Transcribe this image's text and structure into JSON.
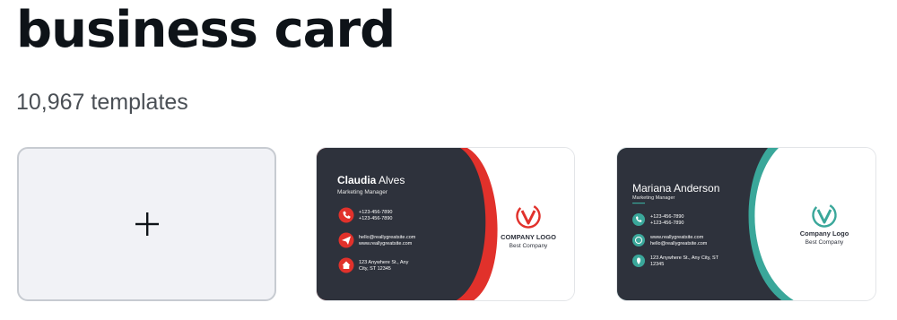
{
  "header": {
    "title": "business card",
    "template_count": "10,967 templates"
  },
  "create_blank": {
    "icon": "plus-icon"
  },
  "templates": [
    {
      "first_name": "Claudia",
      "last_name": "Alves",
      "job_title": "Marketing Manager",
      "phone_1": "+123-456-7890",
      "phone_2": "+123-456-7890",
      "email": "hello@reallygreatsite.com",
      "website": "www.reallygreatsite.com",
      "address_1": "123 Anywhere St., Any",
      "address_2": "City, ST 12345",
      "logo_text": "COMPANY LOGO",
      "company": "Best Company",
      "accent_color": "#e1312b",
      "dark_color": "#2e323c"
    },
    {
      "name": "Mariana Anderson",
      "job_title": "Marketing Manager",
      "phone_1": "+123-456-7890",
      "phone_2": "+123-456-7890",
      "website": "www.reallygreatsite.com",
      "email": "hello@reallygreatsite.com",
      "address_1": "123 Anywhere St., Any City, ST",
      "address_2": "12345",
      "logo_text": "Company Logo",
      "company": "Best Company",
      "accent_color": "#3aa79a",
      "dark_color": "#2e323c"
    }
  ]
}
